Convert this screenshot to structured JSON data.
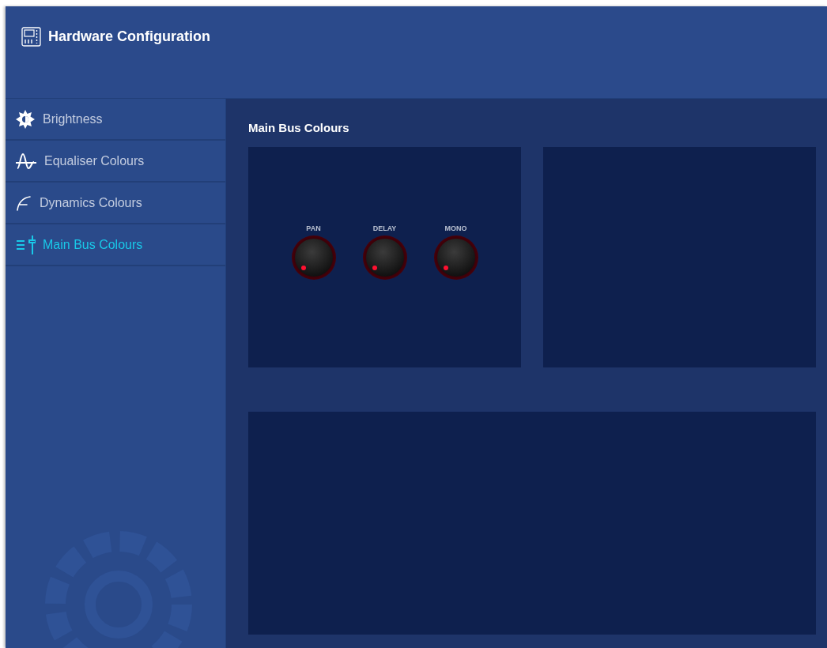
{
  "header": {
    "title": "Hardware Configuration"
  },
  "sidebar": {
    "items": [
      {
        "label": "Brightness",
        "kind": "brightness",
        "selected": false
      },
      {
        "label": "Equaliser Colours",
        "kind": "equaliser",
        "selected": false
      },
      {
        "label": "Dynamics Colours",
        "kind": "dynamics",
        "selected": false
      },
      {
        "label": "Main Bus Colours",
        "kind": "mainbus",
        "selected": true
      }
    ]
  },
  "content": {
    "title": "Main Bus Colours",
    "knobs": [
      {
        "label": "PAN"
      },
      {
        "label": "DELAY"
      },
      {
        "label": "MONO"
      }
    ]
  }
}
